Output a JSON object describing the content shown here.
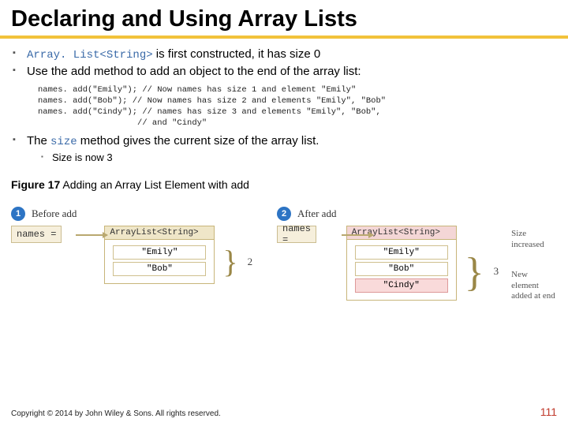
{
  "title": "Declaring and Using Array Lists",
  "bullets": {
    "b1_pre": "Array. List<String>",
    "b1_post": " is first constructed, it has size 0",
    "b2": "Use the add method to add an object to the end of the array list:",
    "b3_pre": "The ",
    "b3_code": "size",
    "b3_post": " method gives the current size of the array list.",
    "sub1": "Size is now 3"
  },
  "code": "names. add(\"Emily\"); // Now names has size 1 and element \"Emily\"\nnames. add(\"Bob\"); // Now names has size 2 and elements \"Emily\", \"Bob\"\nnames. add(\"Cindy\"); // names has size 3 and elements \"Emily\", \"Bob\",\n                    // and \"Cindy\"",
  "figure": {
    "label": "Figure 17",
    "caption": " Adding an Array List Element with add",
    "before": {
      "step": "1",
      "heading": "Before add",
      "var": "names =",
      "type": "ArrayList<String>",
      "elements": [
        "\"Emily\"",
        "\"Bob\""
      ],
      "size": "2"
    },
    "after": {
      "step": "2",
      "heading": "After add",
      "var": "names =",
      "type": "ArrayList<String>",
      "elements": [
        "\"Emily\"",
        "\"Bob\"",
        "\"Cindy\""
      ],
      "size": "3",
      "note1": "Size increased",
      "note2": "New element added at end"
    }
  },
  "footer": {
    "copyright": "Copyright © 2014 by John Wiley & Sons. All rights reserved.",
    "page": "111"
  }
}
